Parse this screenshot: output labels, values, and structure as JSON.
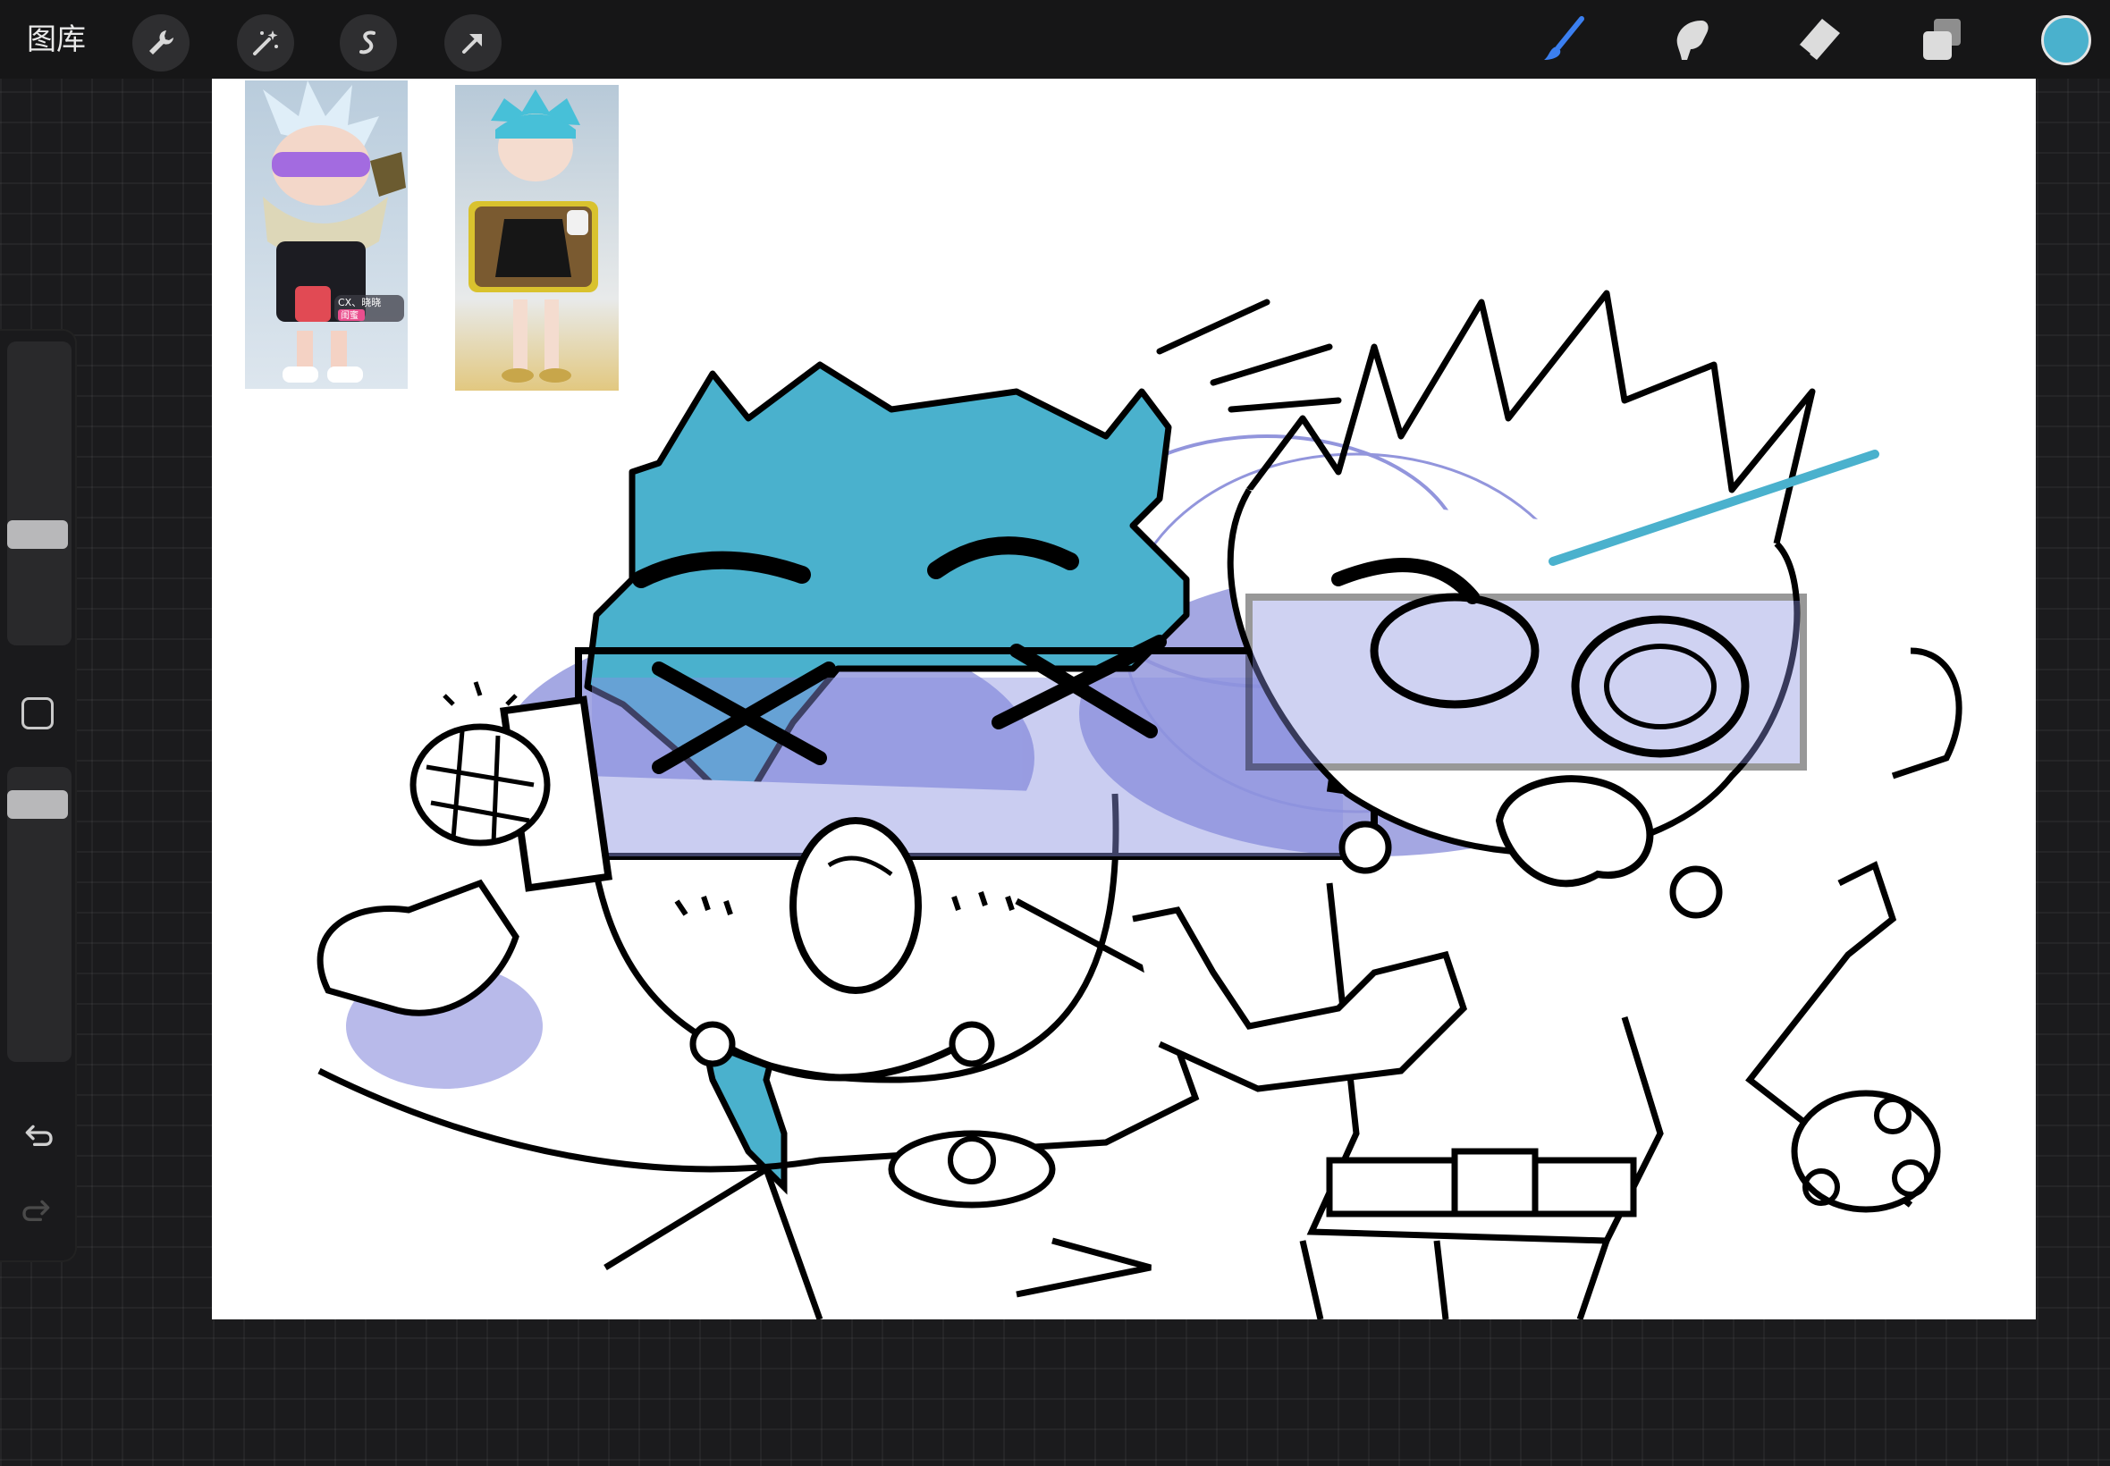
{
  "toolbar": {
    "gallery_label": "图库",
    "left_tools": [
      "wrench-icon",
      "magic-wand-icon",
      "selection-icon",
      "move-arrow-icon"
    ],
    "right_tools": [
      "brush-icon",
      "smudge-icon",
      "eraser-icon",
      "layers-icon"
    ],
    "active_tool": "brush-icon",
    "current_color": "#4ab1cd"
  },
  "sidebar": {
    "size_level": 0.65,
    "opacity_level": 0.9
  },
  "reference": {
    "card_left": {
      "user_text": "CX、晓晓",
      "tag_text": "闺蜜"
    }
  },
  "colors": {
    "accent_blue": "#4ab1cd",
    "scribble_purple": "#2e35b3",
    "ink": "#000000"
  }
}
